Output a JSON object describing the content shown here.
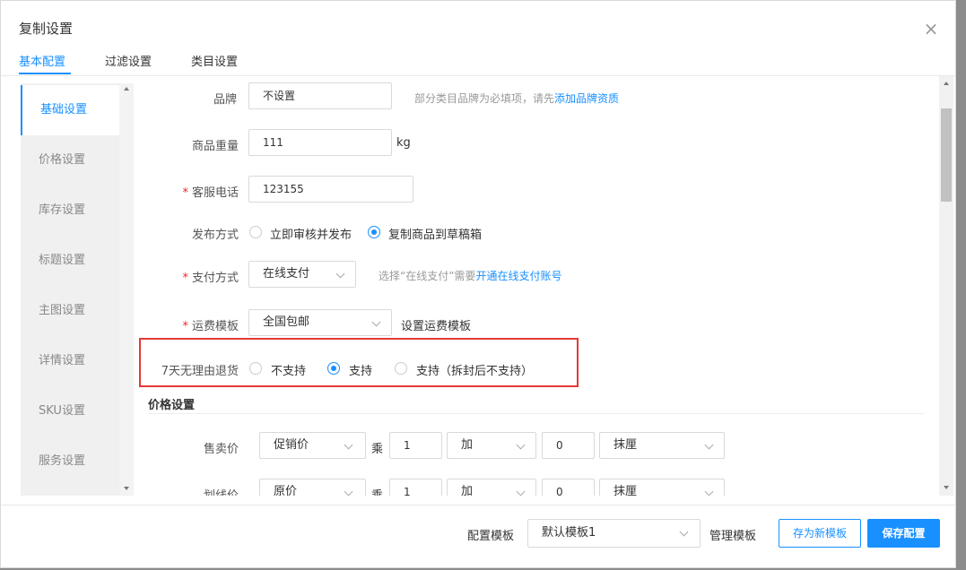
{
  "dialog": {
    "title": "复制设置"
  },
  "tabs": [
    "基本配置",
    "过滤设置",
    "类目设置"
  ],
  "sidebar": {
    "items": [
      "基础设置",
      "价格设置",
      "库存设置",
      "标题设置",
      "主图设置",
      "详情设置",
      "SKU设置",
      "服务设置"
    ]
  },
  "form": {
    "brand": {
      "label": "品牌",
      "value": "不设置",
      "hint": "部分类目品牌为必填项，请先",
      "link": "添加品牌资质"
    },
    "weight": {
      "label": "商品重量",
      "value": "111",
      "unit": "kg"
    },
    "phone": {
      "required": "*",
      "label": "客服电话",
      "value": "123155"
    },
    "publish": {
      "label": "发布方式",
      "options": [
        "立即审核并发布",
        "复制商品到草稿箱"
      ],
      "selected": 1
    },
    "payment": {
      "required": "*",
      "label": "支付方式",
      "value": "在线支付",
      "hint": "选择“在线支付”需要",
      "link": "开通在线支付账号"
    },
    "shipping": {
      "required": "*",
      "label": "运费模板",
      "value": "全国包邮",
      "link": "设置运费模板"
    },
    "returns": {
      "label": "7天无理由退货",
      "options": [
        "不支持",
        "支持",
        "支持（拆封后不支持）"
      ],
      "selected": 1
    }
  },
  "price_section": {
    "title": "价格设置",
    "rows": [
      {
        "label": "售卖价",
        "base": "促销价",
        "multiply_label": "乘",
        "multiplier": "1",
        "op": "加",
        "addend": "0",
        "rounding": "抹厘"
      },
      {
        "label": "划线价",
        "base": "原价",
        "multiply_label": "乘",
        "multiplier": "1",
        "op": "加",
        "addend": "0",
        "rounding": "抹厘"
      }
    ]
  },
  "footer": {
    "template_label": "配置模板",
    "template_value": "默认模板1",
    "manage_link": "管理模板",
    "save_as_new": "存为新模板",
    "save": "保存配置"
  },
  "colors": {
    "accent": "#1890ff",
    "highlight": "#e53935",
    "required": "#f5222d"
  }
}
